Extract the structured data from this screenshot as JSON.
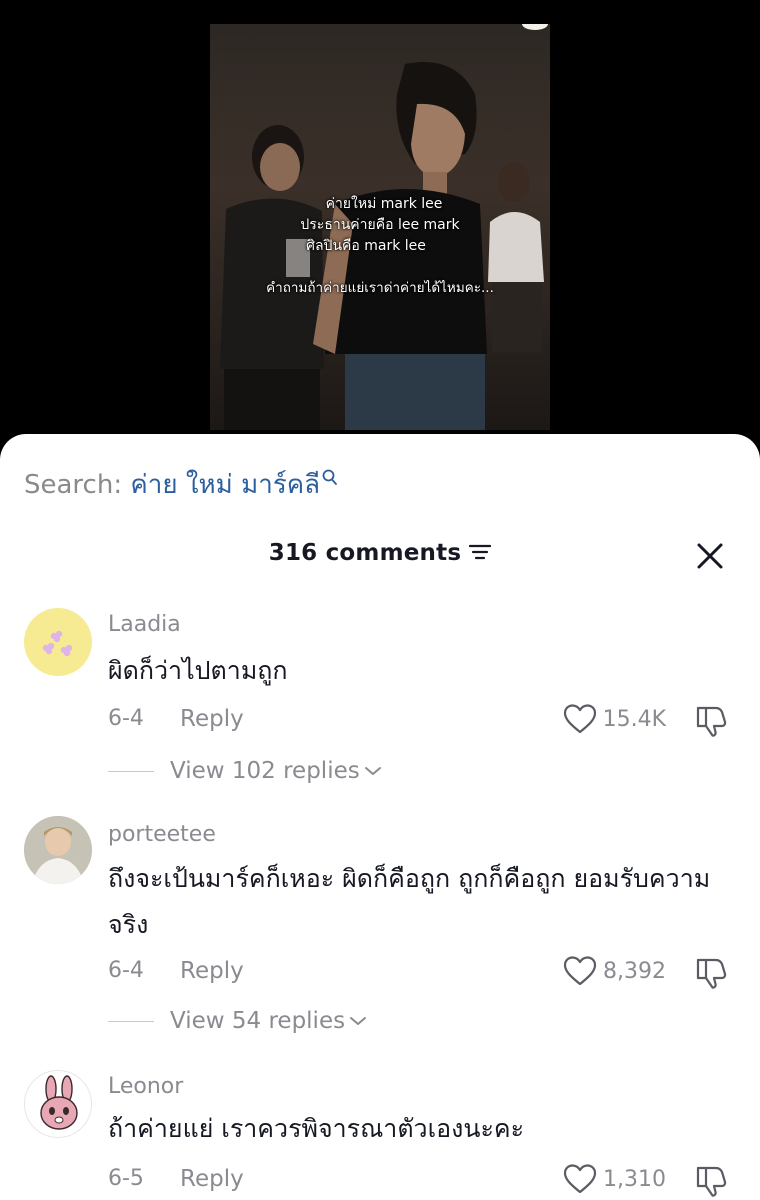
{
  "video": {
    "overlay_lines": [
      "ค่ายใหม่ mark lee",
      "ประธานค่ายคือ lee mark",
      "ศิลปินคือ mark lee",
      "คำถามถ้าค่ายแย่เราด่าค่ายได้ไหมคะ..."
    ]
  },
  "search": {
    "label": "Search:",
    "term": "ค่าย ใหม่ มาร์คลี"
  },
  "header": {
    "comment_count": "316 comments"
  },
  "comments": [
    {
      "username": "Laadia",
      "text": "ผิดก็ว่าไปตามถูก",
      "date": "6-4",
      "reply_label": "Reply",
      "likes": "15.4K",
      "view_replies": "View 102 replies"
    },
    {
      "username": "porteetee",
      "text": "ถึงจะเป้นมาร์คก็เหอะ ผิดก็คือถูก ถูกก็คือถูก ยอมรับความจริง",
      "date": "6-4",
      "reply_label": "Reply",
      "likes": "8,392",
      "view_replies": "View 54 replies"
    },
    {
      "username": "Leonor",
      "text": "ถ้าค่ายแย่ เราควรพิจารณาตัวเองนะคะ",
      "date": "6-5",
      "reply_label": "Reply",
      "likes": "1,310"
    }
  ],
  "colors": {
    "search_term": "#2c5f9e",
    "muted_text": "#8a8b91",
    "primary_text": "#161823",
    "sheet_bg": "#ffffff"
  }
}
